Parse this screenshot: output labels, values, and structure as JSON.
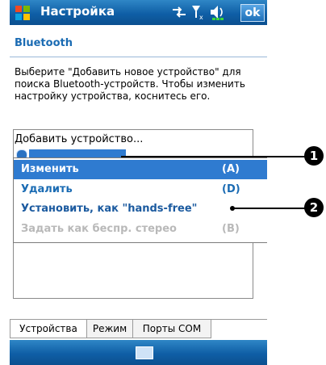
{
  "titlebar": {
    "title": "Настройка",
    "ok_label": "ok",
    "icons": [
      "windows-start-icon",
      "connectivity-icon",
      "signal-icon",
      "volume-icon"
    ]
  },
  "header": {
    "title": "Bluetooth"
  },
  "instructions": "Выберите \"Добавить новое устройство\" для поиска Bluetooth-устройств. Чтобы изменить настройку устройства, коснитесь его.",
  "list": {
    "add_device": "Добавить устройство..."
  },
  "context_menu": {
    "items": [
      {
        "label": "Изменить",
        "key": "(A)",
        "state": "selected"
      },
      {
        "label": "Удалить",
        "key": "(D)",
        "state": "normal"
      },
      {
        "label": "Установить, как \"hands-free\"",
        "key": "",
        "state": "normal"
      },
      {
        "label": "Задать как беспр. стерео",
        "key": "(B)",
        "state": "disabled"
      }
    ]
  },
  "callouts": [
    "1",
    "2"
  ],
  "tabs": [
    "Устройства",
    "Режим",
    "Порты COM"
  ],
  "colors": {
    "accent": "#1a6bb3",
    "titlebar": "#0f5fa6",
    "selection": "#2f7bd0"
  }
}
